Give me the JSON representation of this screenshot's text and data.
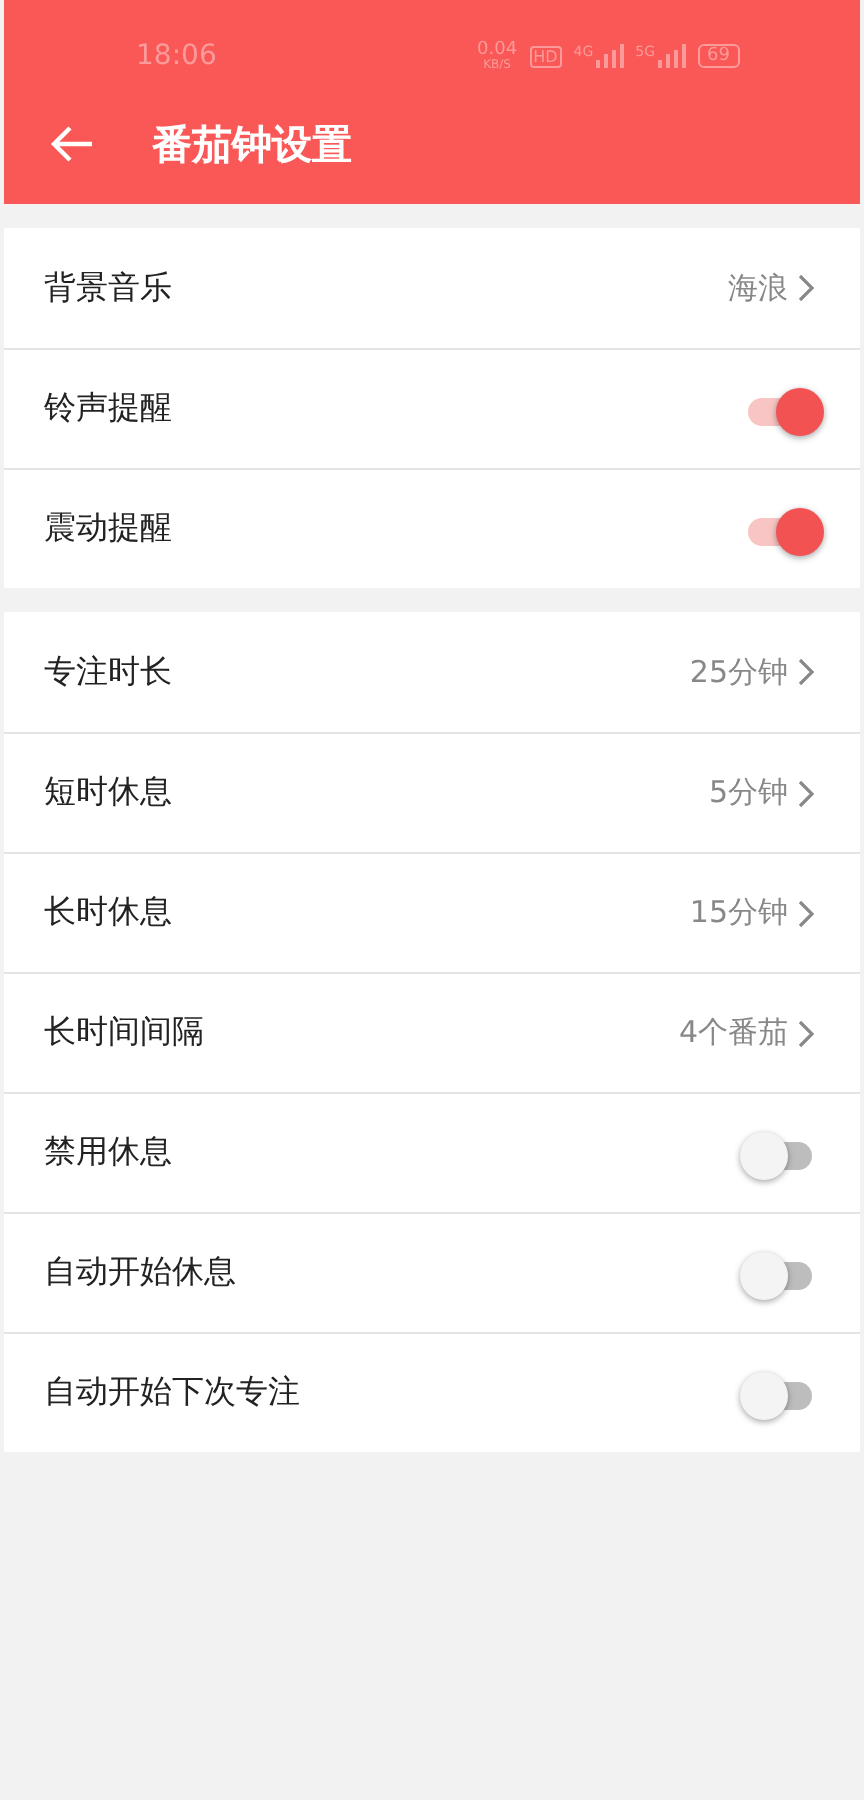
{
  "status_bar": {
    "time": "18:06",
    "speed": "0.04",
    "speed_unit": "KB/S",
    "hd": "HD",
    "network_1": "4G",
    "network_2": "5G",
    "battery": "69"
  },
  "header": {
    "title": "番茄钟设置"
  },
  "sections": [
    {
      "rows": [
        {
          "kind": "link",
          "label": "背景音乐",
          "value": "海浪"
        },
        {
          "kind": "switch",
          "label": "铃声提醒",
          "on": true
        },
        {
          "kind": "switch",
          "label": "震动提醒",
          "on": true
        }
      ]
    },
    {
      "rows": [
        {
          "kind": "link",
          "label": "专注时长",
          "value": "25分钟"
        },
        {
          "kind": "link",
          "label": "短时休息",
          "value": "5分钟"
        },
        {
          "kind": "link",
          "label": "长时休息",
          "value": "15分钟"
        },
        {
          "kind": "link",
          "label": "长时间间隔",
          "value": "4个番茄"
        },
        {
          "kind": "switch",
          "label": "禁用休息",
          "on": false
        },
        {
          "kind": "switch",
          "label": "自动开始休息",
          "on": false
        },
        {
          "kind": "switch",
          "label": "自动开始下次专注",
          "on": false
        }
      ]
    }
  ]
}
